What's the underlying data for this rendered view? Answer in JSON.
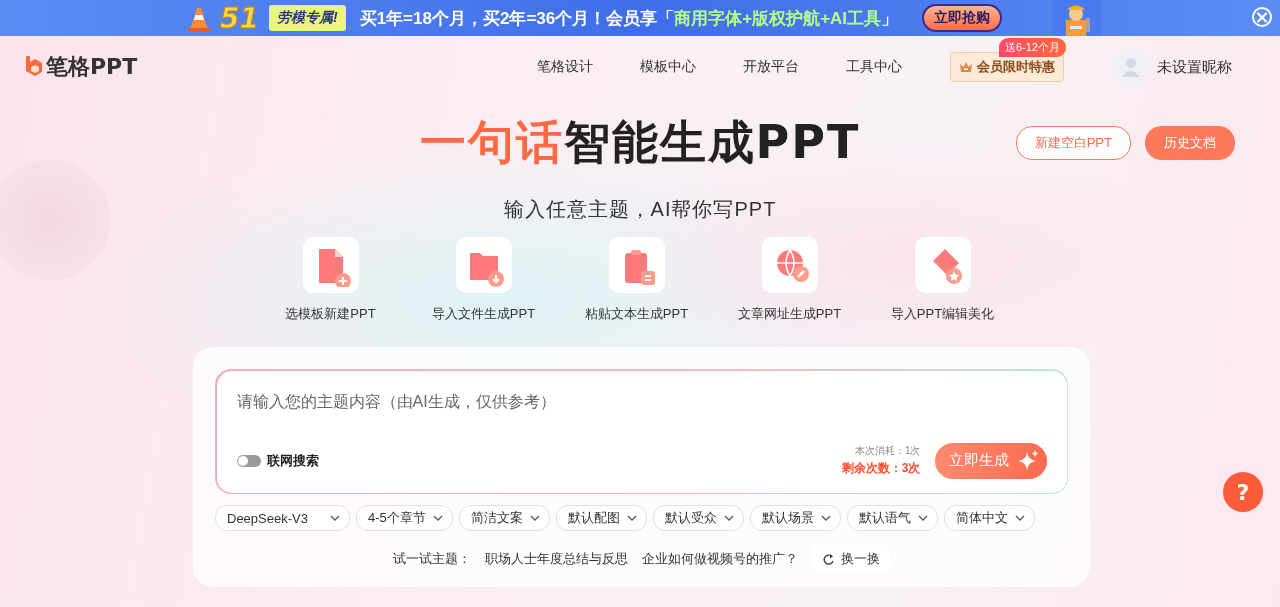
{
  "banner": {
    "number": "51",
    "tag": "劳模专属!",
    "offer": [
      {
        "text": "买1年=18个月，买2年=36个月！会员享「",
        "highlight": false
      },
      {
        "text": "商用字体+版权护航+AI工具",
        "highlight": true
      },
      {
        "text": "」",
        "highlight": false
      }
    ],
    "button": "立即抢购",
    "close": "×"
  },
  "header": {
    "logo": "笔格PPT",
    "nav": [
      {
        "label": "笔格设计"
      },
      {
        "label": "模板中心"
      },
      {
        "label": "开放平台"
      },
      {
        "label": "工具中心"
      }
    ],
    "vip": {
      "label": "会员限时特惠",
      "badge": "送6-12个月"
    },
    "user": "未设置昵称"
  },
  "hero": {
    "title_highlight": "一句话",
    "title_rest": "智能生成PPT",
    "subtitle": "输入任意主题，AI帮你写PPT",
    "buttons": [
      {
        "label": "新建空白PPT",
        "kind": "outline"
      },
      {
        "label": "历史文档",
        "kind": "filled"
      }
    ],
    "features": [
      {
        "label": "选模板新建PPT",
        "kind": "doc-plus"
      },
      {
        "label": "导入文件生成PPT",
        "kind": "folder-down"
      },
      {
        "label": "粘贴文本生成PPT",
        "kind": "clipboard"
      },
      {
        "label": "文章网址生成PPT",
        "kind": "globe-link"
      },
      {
        "label": "导入PPT编辑美化",
        "kind": "tag-star"
      }
    ]
  },
  "generator": {
    "prompt": {
      "placeholder": "请输入您的主题内容（由AI生成，仅供参考）"
    },
    "web_search": {
      "label": "联网搜索",
      "on": false
    },
    "cost": "本次消耗：1次",
    "remaining": "剩余次数：3次",
    "generate": "立即生成",
    "options": [
      {
        "value": "DeepSeek-V3"
      },
      {
        "value": "4-5个章节"
      },
      {
        "value": "简洁文案"
      },
      {
        "value": "默认配图"
      },
      {
        "value": "默认受众"
      },
      {
        "value": "默认场景"
      },
      {
        "value": "默认语气"
      },
      {
        "value": "简体中文"
      }
    ],
    "suggestions": {
      "label": "试一试主题：",
      "items": [
        "职场人士年度总结与反思",
        "企业如何做视频号的推广？"
      ],
      "refresh": "换一换"
    }
  },
  "help": "?"
}
